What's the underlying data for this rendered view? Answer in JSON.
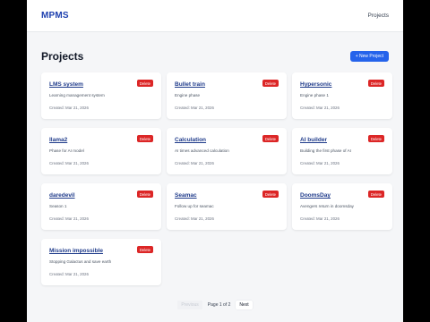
{
  "navbar": {
    "brand": "MPMS",
    "link": "Projects"
  },
  "page": {
    "title": "Projects",
    "new_button": "+ New Project"
  },
  "projects": [
    {
      "title": "LMS system",
      "description": "Learning management system",
      "created": "Created: Mar 21, 2026",
      "delete_label": "Delete"
    },
    {
      "title": "Bullet train",
      "description": "Engine phase",
      "created": "Created: Mar 21, 2026",
      "delete_label": "Delete"
    },
    {
      "title": "Hypersonic",
      "description": "Engine phase 1",
      "created": "Created: Mar 21, 2026",
      "delete_label": "Delete"
    },
    {
      "title": "llama2",
      "description": "Phase for AI model",
      "created": "Created: Mar 21, 2026",
      "delete_label": "Delete"
    },
    {
      "title": "Calculation",
      "description": "AI times advanced calculation",
      "created": "Created: Mar 21, 2026",
      "delete_label": "Delete"
    },
    {
      "title": "AI builder",
      "description": "Building the first phase of AI",
      "created": "Created: Mar 21, 2026",
      "delete_label": "Delete"
    },
    {
      "title": "daredevil",
      "description": "Season 1",
      "created": "Created: Mar 21, 2026",
      "delete_label": "Delete"
    },
    {
      "title": "Seamac",
      "description": "Follow up for seamac",
      "created": "Created: Mar 21, 2026",
      "delete_label": "Delete"
    },
    {
      "title": "DoomsDay",
      "description": "Avengers return in doomsday",
      "created": "Created: Mar 21, 2026",
      "delete_label": "Delete"
    },
    {
      "title": "Mission impossible",
      "description": "Stopping Galactus and save earth",
      "created": "Created: Mar 21, 2026",
      "delete_label": "Delete"
    }
  ],
  "pagination": {
    "previous": "Previous",
    "info": "Page 1 of 2",
    "next": "Next"
  },
  "colors": {
    "brand": "#1e40af",
    "primary": "#2563eb",
    "danger": "#dc2626"
  }
}
